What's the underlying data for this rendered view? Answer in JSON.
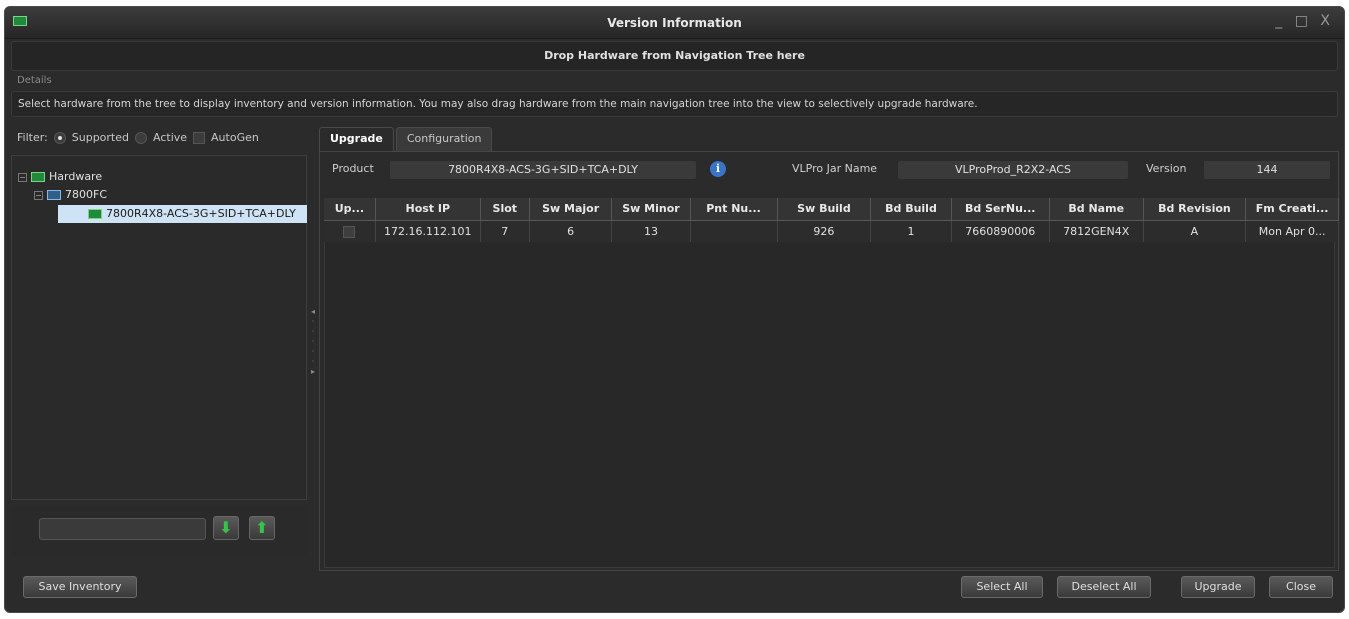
{
  "window": {
    "title": "Version Information",
    "controls": "_ □ X",
    "drop_hint": "Drop Hardware from Navigation Tree here"
  },
  "details": {
    "label": "Details",
    "text": "Select hardware from the tree to display inventory and version information.  You may also drag hardware from the main navigation tree into the view to selectively upgrade hardware."
  },
  "filter": {
    "label": "Filter:",
    "options": [
      "Supported",
      "Active",
      "AutoGen"
    ],
    "selected": "Supported"
  },
  "tree": {
    "root": "Hardware",
    "frame": "7800FC",
    "card": "7800R4X8-ACS-3G+SID+TCA+DLY"
  },
  "search": {
    "value": ""
  },
  "tabs": [
    "Upgrade",
    "Configuration"
  ],
  "active_tab": "Upgrade",
  "product": {
    "product_label": "Product",
    "product_value": "7800R4X8-ACS-3G+SID+TCA+DLY",
    "jar_label": "VLPro  Jar Name",
    "jar_value": "VLProProd_R2X2-ACS",
    "version_label": "Version",
    "version_value": "144"
  },
  "table": {
    "headers": [
      "Up...",
      "Host IP",
      "Slot",
      "Sw Major",
      "Sw Minor",
      "Pnt Nu...",
      "Sw Build",
      "Bd Build",
      "Bd SerNu...",
      "Bd Name",
      "Bd Revision",
      "Fm Creati..."
    ],
    "rows": [
      [
        "",
        "172.16.112.101",
        "7",
        "6",
        "13",
        "",
        "926",
        "1",
        "7660890006",
        "7812GEN4X",
        "A",
        "Mon Apr 0..."
      ]
    ]
  },
  "buttons": {
    "save_inventory": "Save Inventory",
    "select_all": "Select All",
    "deselect_all": "Deselect All",
    "upgrade": "Upgrade",
    "close": "Close"
  },
  "colors": {
    "background": "#2b2b2b",
    "selection": "#cfe3f7",
    "accent_green": "#39c24a",
    "info_blue": "#3b73c6"
  }
}
